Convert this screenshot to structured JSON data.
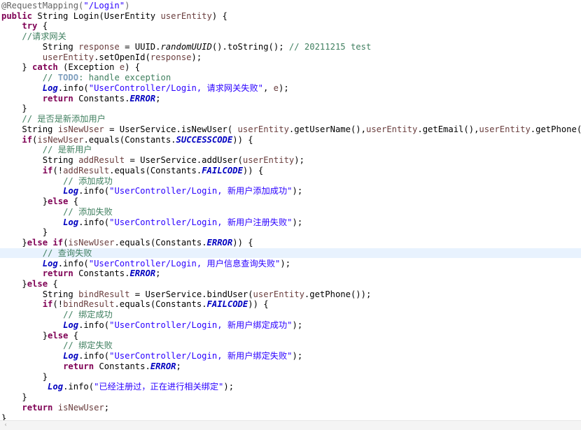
{
  "editor": {
    "highlighted_line": 24,
    "lines": [
      [
        [
          "@RequestMapping(",
          "ann"
        ],
        [
          "\"/Login\"",
          "str"
        ],
        [
          ")",
          "ann"
        ]
      ],
      [
        [
          "public",
          "kw"
        ],
        [
          " String Login(UserEntity ",
          "plain"
        ],
        [
          "userEntity",
          "var"
        ],
        [
          ") {",
          "plain"
        ]
      ],
      [
        [
          "    ",
          "plain"
        ],
        [
          "try",
          "kw"
        ],
        [
          " {",
          "plain"
        ]
      ],
      [
        [
          "    ",
          "plain"
        ],
        [
          "//请求网关",
          "com"
        ]
      ],
      [
        [
          "        String ",
          "plain"
        ],
        [
          "response",
          "var"
        ],
        [
          " = UUID.",
          "plain"
        ],
        [
          "randomUUID",
          "smethod"
        ],
        [
          "().toString(); ",
          "plain"
        ],
        [
          "// 20211215 test",
          "com"
        ]
      ],
      [
        [
          "        ",
          "plain"
        ],
        [
          "userEntity",
          "var"
        ],
        [
          ".setOpenId(",
          "plain"
        ],
        [
          "response",
          "var"
        ],
        [
          ");",
          "plain"
        ]
      ],
      [
        [
          "    } ",
          "plain"
        ],
        [
          "catch",
          "kw"
        ],
        [
          " (Exception ",
          "plain"
        ],
        [
          "e",
          "var"
        ],
        [
          ") {",
          "plain"
        ]
      ],
      [
        [
          "        ",
          "plain"
        ],
        [
          "// ",
          "com"
        ],
        [
          "TODO",
          "todo"
        ],
        [
          ": handle exception",
          "com"
        ]
      ],
      [
        [
          "        ",
          "plain"
        ],
        [
          "Log",
          "static"
        ],
        [
          ".info(",
          "plain"
        ],
        [
          "\"UserController/Login, 请求网关失败\"",
          "str"
        ],
        [
          ", ",
          "plain"
        ],
        [
          "e",
          "var"
        ],
        [
          ");",
          "plain"
        ]
      ],
      [
        [
          "        ",
          "plain"
        ],
        [
          "return",
          "kw"
        ],
        [
          " Constants.",
          "plain"
        ],
        [
          "ERROR",
          "static"
        ],
        [
          ";",
          "plain"
        ]
      ],
      [
        [
          "    }",
          "plain"
        ]
      ],
      [
        [
          "    ",
          "plain"
        ],
        [
          "// 是否是新添加用户",
          "com"
        ]
      ],
      [
        [
          "    String ",
          "plain"
        ],
        [
          "isNewUser",
          "var"
        ],
        [
          " = UserService.isNewUser( ",
          "plain"
        ],
        [
          "userEntity",
          "var"
        ],
        [
          ".getUserName(),",
          "plain"
        ],
        [
          "userEntity",
          "var"
        ],
        [
          ".getEmail(),",
          "plain"
        ],
        [
          "userEntity",
          "var"
        ],
        [
          ".getPhone());",
          "plain"
        ]
      ],
      [
        [
          "    ",
          "plain"
        ],
        [
          "if",
          "kw"
        ],
        [
          "(",
          "plain"
        ],
        [
          "isNewUser",
          "var"
        ],
        [
          ".equals(Constants.",
          "plain"
        ],
        [
          "SUCCESSCODE",
          "static"
        ],
        [
          ")) {",
          "plain"
        ]
      ],
      [
        [
          "        ",
          "plain"
        ],
        [
          "// 是新用户",
          "com"
        ]
      ],
      [
        [
          "        String ",
          "plain"
        ],
        [
          "addResult",
          "var"
        ],
        [
          " = UserService.addUser(",
          "plain"
        ],
        [
          "userEntity",
          "var"
        ],
        [
          ");",
          "plain"
        ]
      ],
      [
        [
          "        ",
          "plain"
        ],
        [
          "if",
          "kw"
        ],
        [
          "(!",
          "plain"
        ],
        [
          "addResult",
          "var"
        ],
        [
          ".equals(Constants.",
          "plain"
        ],
        [
          "FAILCODE",
          "static"
        ],
        [
          ")) {",
          "plain"
        ]
      ],
      [
        [
          "            ",
          "plain"
        ],
        [
          "// 添加成功",
          "com"
        ]
      ],
      [
        [
          "            ",
          "plain"
        ],
        [
          "Log",
          "static"
        ],
        [
          ".info(",
          "plain"
        ],
        [
          "\"UserController/Login, 新用户添加成功\"",
          "str"
        ],
        [
          ");",
          "plain"
        ]
      ],
      [
        [
          "        }",
          "plain"
        ],
        [
          "else",
          "kw"
        ],
        [
          " {",
          "plain"
        ]
      ],
      [
        [
          "            ",
          "plain"
        ],
        [
          "// 添加失败",
          "com"
        ]
      ],
      [
        [
          "            ",
          "plain"
        ],
        [
          "Log",
          "static"
        ],
        [
          ".info(",
          "plain"
        ],
        [
          "\"UserController/Login, 新用户注册失败\"",
          "str"
        ],
        [
          ");",
          "plain"
        ]
      ],
      [
        [
          "        }",
          "plain"
        ]
      ],
      [
        [
          "    }",
          "plain"
        ],
        [
          "else",
          "kw"
        ],
        [
          " ",
          "plain"
        ],
        [
          "if",
          "kw"
        ],
        [
          "(",
          "plain"
        ],
        [
          "isNewUser",
          "var"
        ],
        [
          ".equals(Constants.",
          "plain"
        ],
        [
          "ERROR",
          "static"
        ],
        [
          ")) {",
          "plain"
        ]
      ],
      [
        [
          "        ",
          "plain"
        ],
        [
          "// 查询失败",
          "com"
        ]
      ],
      [
        [
          "        ",
          "plain"
        ],
        [
          "Log",
          "static"
        ],
        [
          ".info(",
          "plain"
        ],
        [
          "\"UserController/Login, 用户信息查询失败\"",
          "str"
        ],
        [
          ");",
          "plain"
        ]
      ],
      [
        [
          "        ",
          "plain"
        ],
        [
          "return",
          "kw"
        ],
        [
          " Constants.",
          "plain"
        ],
        [
          "ERROR",
          "static"
        ],
        [
          ";",
          "plain"
        ]
      ],
      [
        [
          "    }",
          "plain"
        ],
        [
          "else",
          "kw"
        ],
        [
          " {",
          "plain"
        ]
      ],
      [
        [
          "        String ",
          "plain"
        ],
        [
          "bindResult",
          "var"
        ],
        [
          " = UserService.bindUser(",
          "plain"
        ],
        [
          "userEntity",
          "var"
        ],
        [
          ".getPhone());",
          "plain"
        ]
      ],
      [
        [
          "        ",
          "plain"
        ],
        [
          "if",
          "kw"
        ],
        [
          "(!",
          "plain"
        ],
        [
          "bindResult",
          "var"
        ],
        [
          ".equals(Constants.",
          "plain"
        ],
        [
          "FAILCODE",
          "static"
        ],
        [
          ")) {",
          "plain"
        ]
      ],
      [
        [
          "            ",
          "plain"
        ],
        [
          "// 绑定成功",
          "com"
        ]
      ],
      [
        [
          "            ",
          "plain"
        ],
        [
          "Log",
          "static"
        ],
        [
          ".info(",
          "plain"
        ],
        [
          "\"UserController/Login, 新用户绑定成功\"",
          "str"
        ],
        [
          ");",
          "plain"
        ]
      ],
      [
        [
          "        }",
          "plain"
        ],
        [
          "else",
          "kw"
        ],
        [
          " {",
          "plain"
        ]
      ],
      [
        [
          "            ",
          "plain"
        ],
        [
          "// 绑定失败",
          "com"
        ]
      ],
      [
        [
          "            ",
          "plain"
        ],
        [
          "Log",
          "static"
        ],
        [
          ".info(",
          "plain"
        ],
        [
          "\"UserController/Login, 新用户绑定失败\"",
          "str"
        ],
        [
          ");",
          "plain"
        ]
      ],
      [
        [
          "            ",
          "plain"
        ],
        [
          "return",
          "kw"
        ],
        [
          " Constants.",
          "plain"
        ],
        [
          "ERROR",
          "static"
        ],
        [
          ";",
          "plain"
        ]
      ],
      [
        [
          "        }",
          "plain"
        ]
      ],
      [
        [
          "         ",
          "plain"
        ],
        [
          "Log",
          "static"
        ],
        [
          ".info(",
          "plain"
        ],
        [
          "\"已经注册过，正在进行相关绑定\"",
          "str"
        ],
        [
          ");",
          "plain"
        ]
      ],
      [
        [
          "    }",
          "plain"
        ]
      ],
      [
        [
          "    ",
          "plain"
        ],
        [
          "return",
          "kw"
        ],
        [
          " ",
          "plain"
        ],
        [
          "isNewUser",
          "var"
        ],
        [
          ";",
          "plain"
        ]
      ],
      [
        [
          "}",
          "plain"
        ]
      ]
    ]
  },
  "scrollbar": {
    "left_arrow_icon": "chevron-left-icon",
    "left_arrow_glyph": "‹"
  },
  "colors": {
    "keyword": "#7f0055",
    "string": "#2a00ff",
    "comment": "#3f7f5f",
    "variable": "#6a3e3e",
    "static_field": "#0000c0",
    "annotation": "#646464",
    "current_line": "#e8f2fe"
  }
}
